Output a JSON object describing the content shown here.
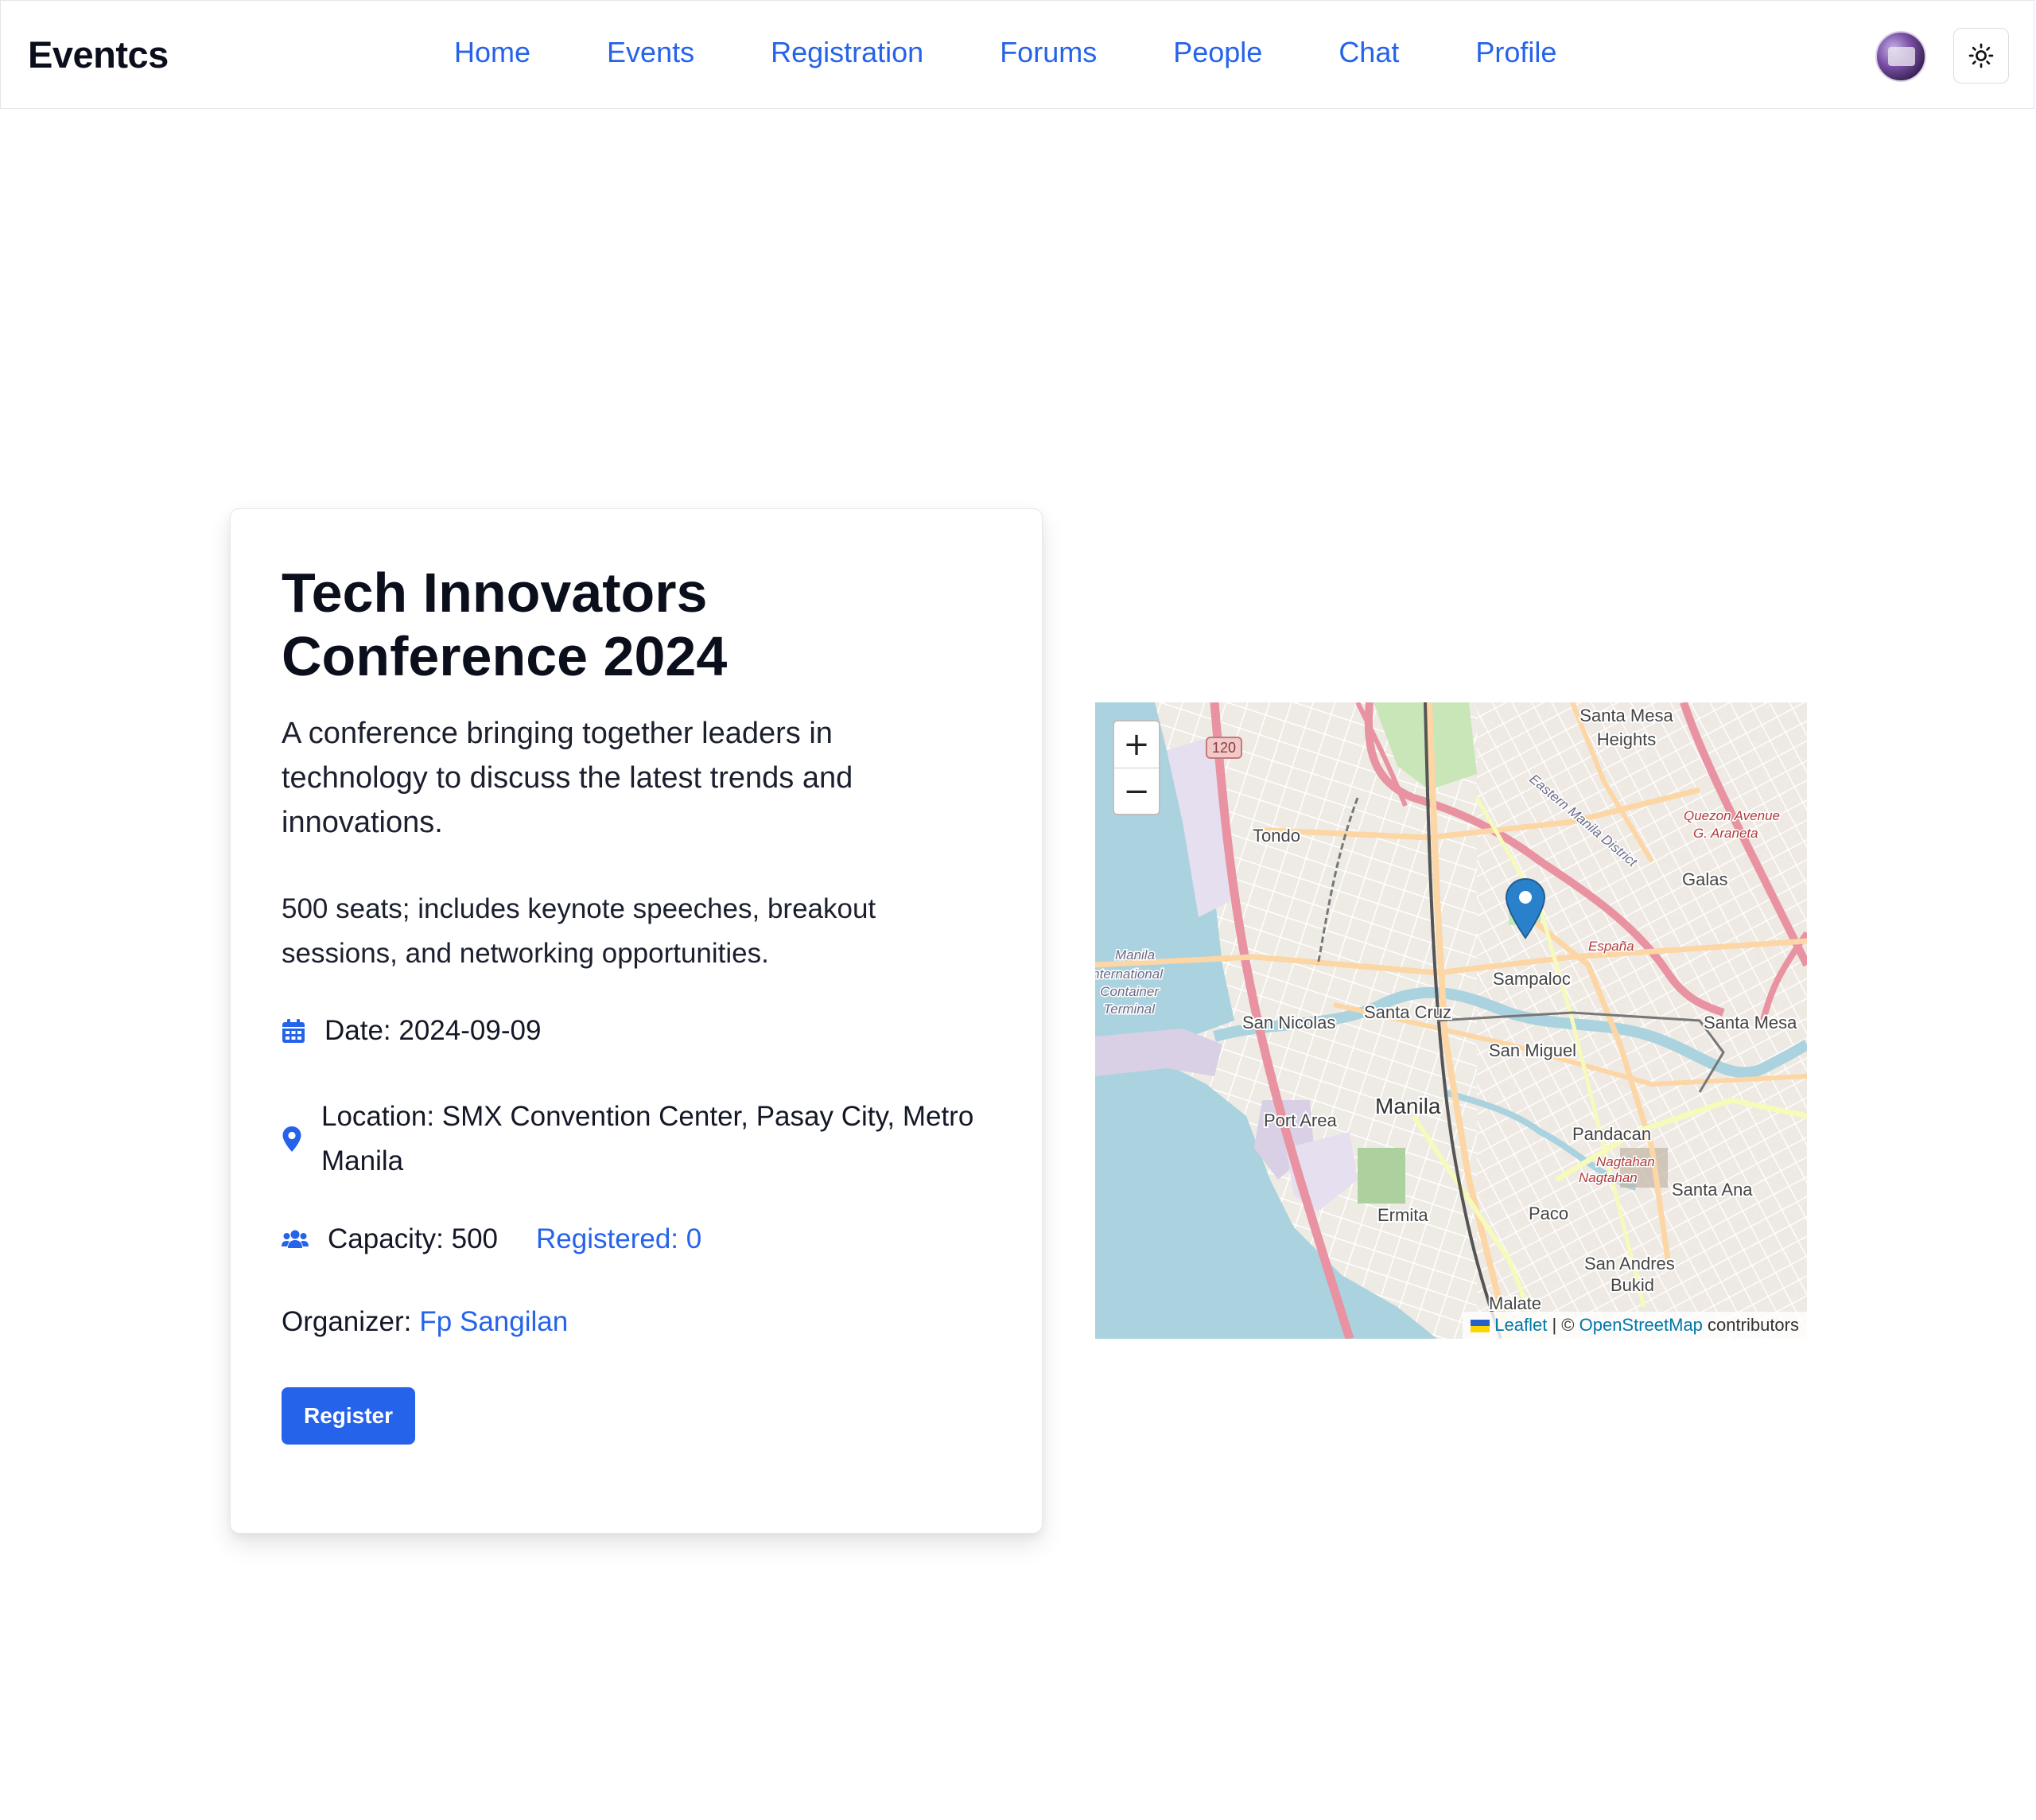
{
  "header": {
    "brand": "Eventcs",
    "nav": [
      "Home",
      "Events",
      "Registration",
      "Forums",
      "People",
      "Chat",
      "Profile"
    ]
  },
  "event": {
    "title": "Tech Innovators Conference 2024",
    "description": "A conference bringing together leaders in technology to discuss the latest trends and innovations.",
    "details": "500 seats; includes keynote speeches, breakout sessions, and networking opportunities.",
    "date": "Date: 2024-09-09",
    "location": "Location: SMX Convention Center, Pasay City, Metro Manila",
    "capacity": "Capacity: 500",
    "registered": "Registered: 0",
    "organizer_label": "Organizer:",
    "organizer_name": "Fp Sangilan",
    "register_label": "Register"
  },
  "map": {
    "zoom_in": "+",
    "zoom_out": "−",
    "attribution": {
      "leaflet": "Leaflet",
      "separator": "| ©",
      "osm": "OpenStreetMap",
      "suffix": "contributors"
    },
    "place_labels": [
      "Santa Mesa Heights",
      "Tondo",
      "Quezon Avenue",
      "G. Araneta",
      "Galas",
      "Eastern Manila District",
      "España",
      "Manila International Container Terminal",
      "Sampaloc",
      "San Nicolas",
      "Santa Cruz",
      "San Miguel",
      "Santa Mesa",
      "Port Area",
      "Manila",
      "Pandacan",
      "Nagtahan",
      "Santa Ana",
      "Ermita",
      "Paco",
      "San Andres Bukid",
      "Malate",
      "120"
    ],
    "colors": {
      "water": "#aad3df",
      "major_road": "#e892a2",
      "secondary_road": "#fcd6a4",
      "marker": "#2a81cb"
    }
  },
  "colors": {
    "accent": "#2563eb",
    "text": "#0b0f1c"
  },
  "icons": [
    "calendar-icon",
    "map-pin-icon",
    "users-icon",
    "sun-icon",
    "map-marker-icon"
  ]
}
